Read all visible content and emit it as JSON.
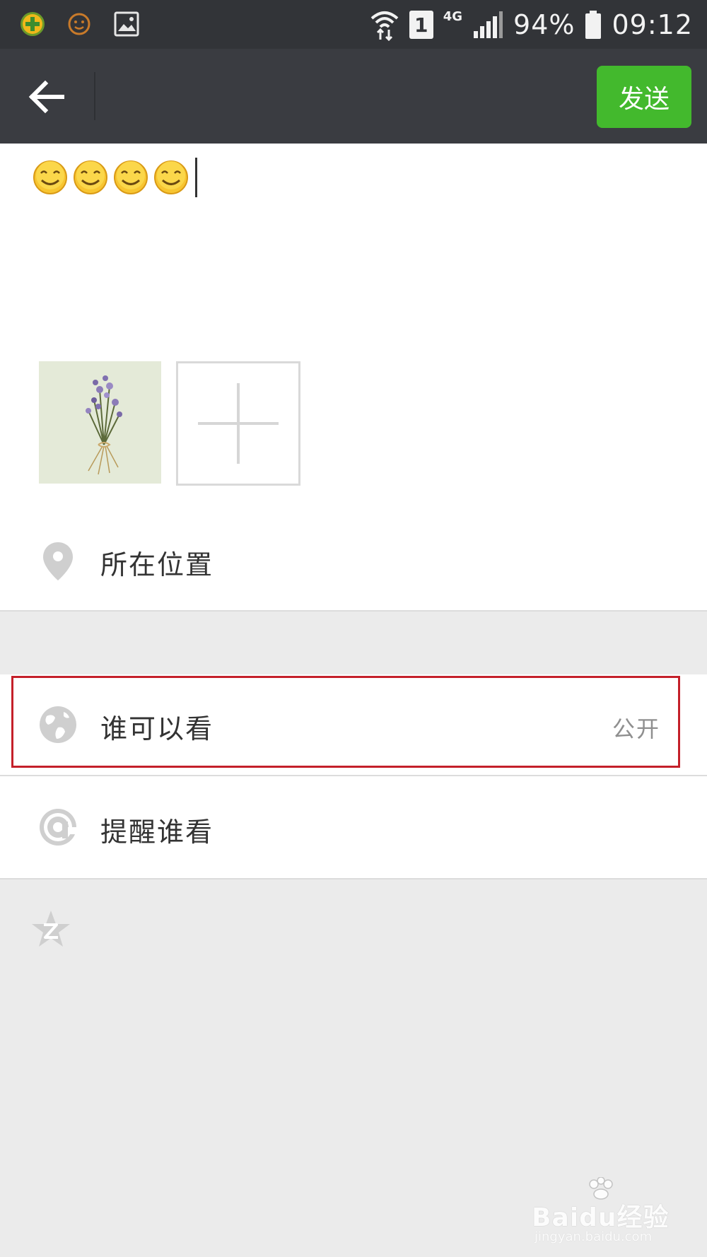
{
  "status_bar": {
    "network_type": "4G",
    "sim_slot": "1",
    "battery": "94%",
    "time": "09:12",
    "icons": [
      "plus-app-icon",
      "emoji-notification-icon",
      "gallery-icon",
      "wifi-icon",
      "sim-icon",
      "signal-icon",
      "battery-icon"
    ]
  },
  "header": {
    "back_icon": "back-arrow-icon",
    "send_label": "发送",
    "send_color": "#43b92d"
  },
  "composer": {
    "emojis": [
      "smile",
      "smile",
      "smile",
      "smile"
    ],
    "photos": [
      "flower-bouquet-photo"
    ],
    "add_icon": "plus-icon"
  },
  "options": {
    "location": {
      "icon": "location-pin-icon",
      "label": "所在位置"
    },
    "visibility": {
      "icon": "globe-icon",
      "label": "谁可以看",
      "value": "公开"
    },
    "mention": {
      "icon": "at-sign-icon",
      "label": "提醒谁看"
    },
    "qzone": {
      "icon": "qzone-star-icon"
    }
  },
  "highlight_color": "#c4202a",
  "watermark": {
    "main": "Baidu经验",
    "sub": "jingyan.baidu.com"
  }
}
